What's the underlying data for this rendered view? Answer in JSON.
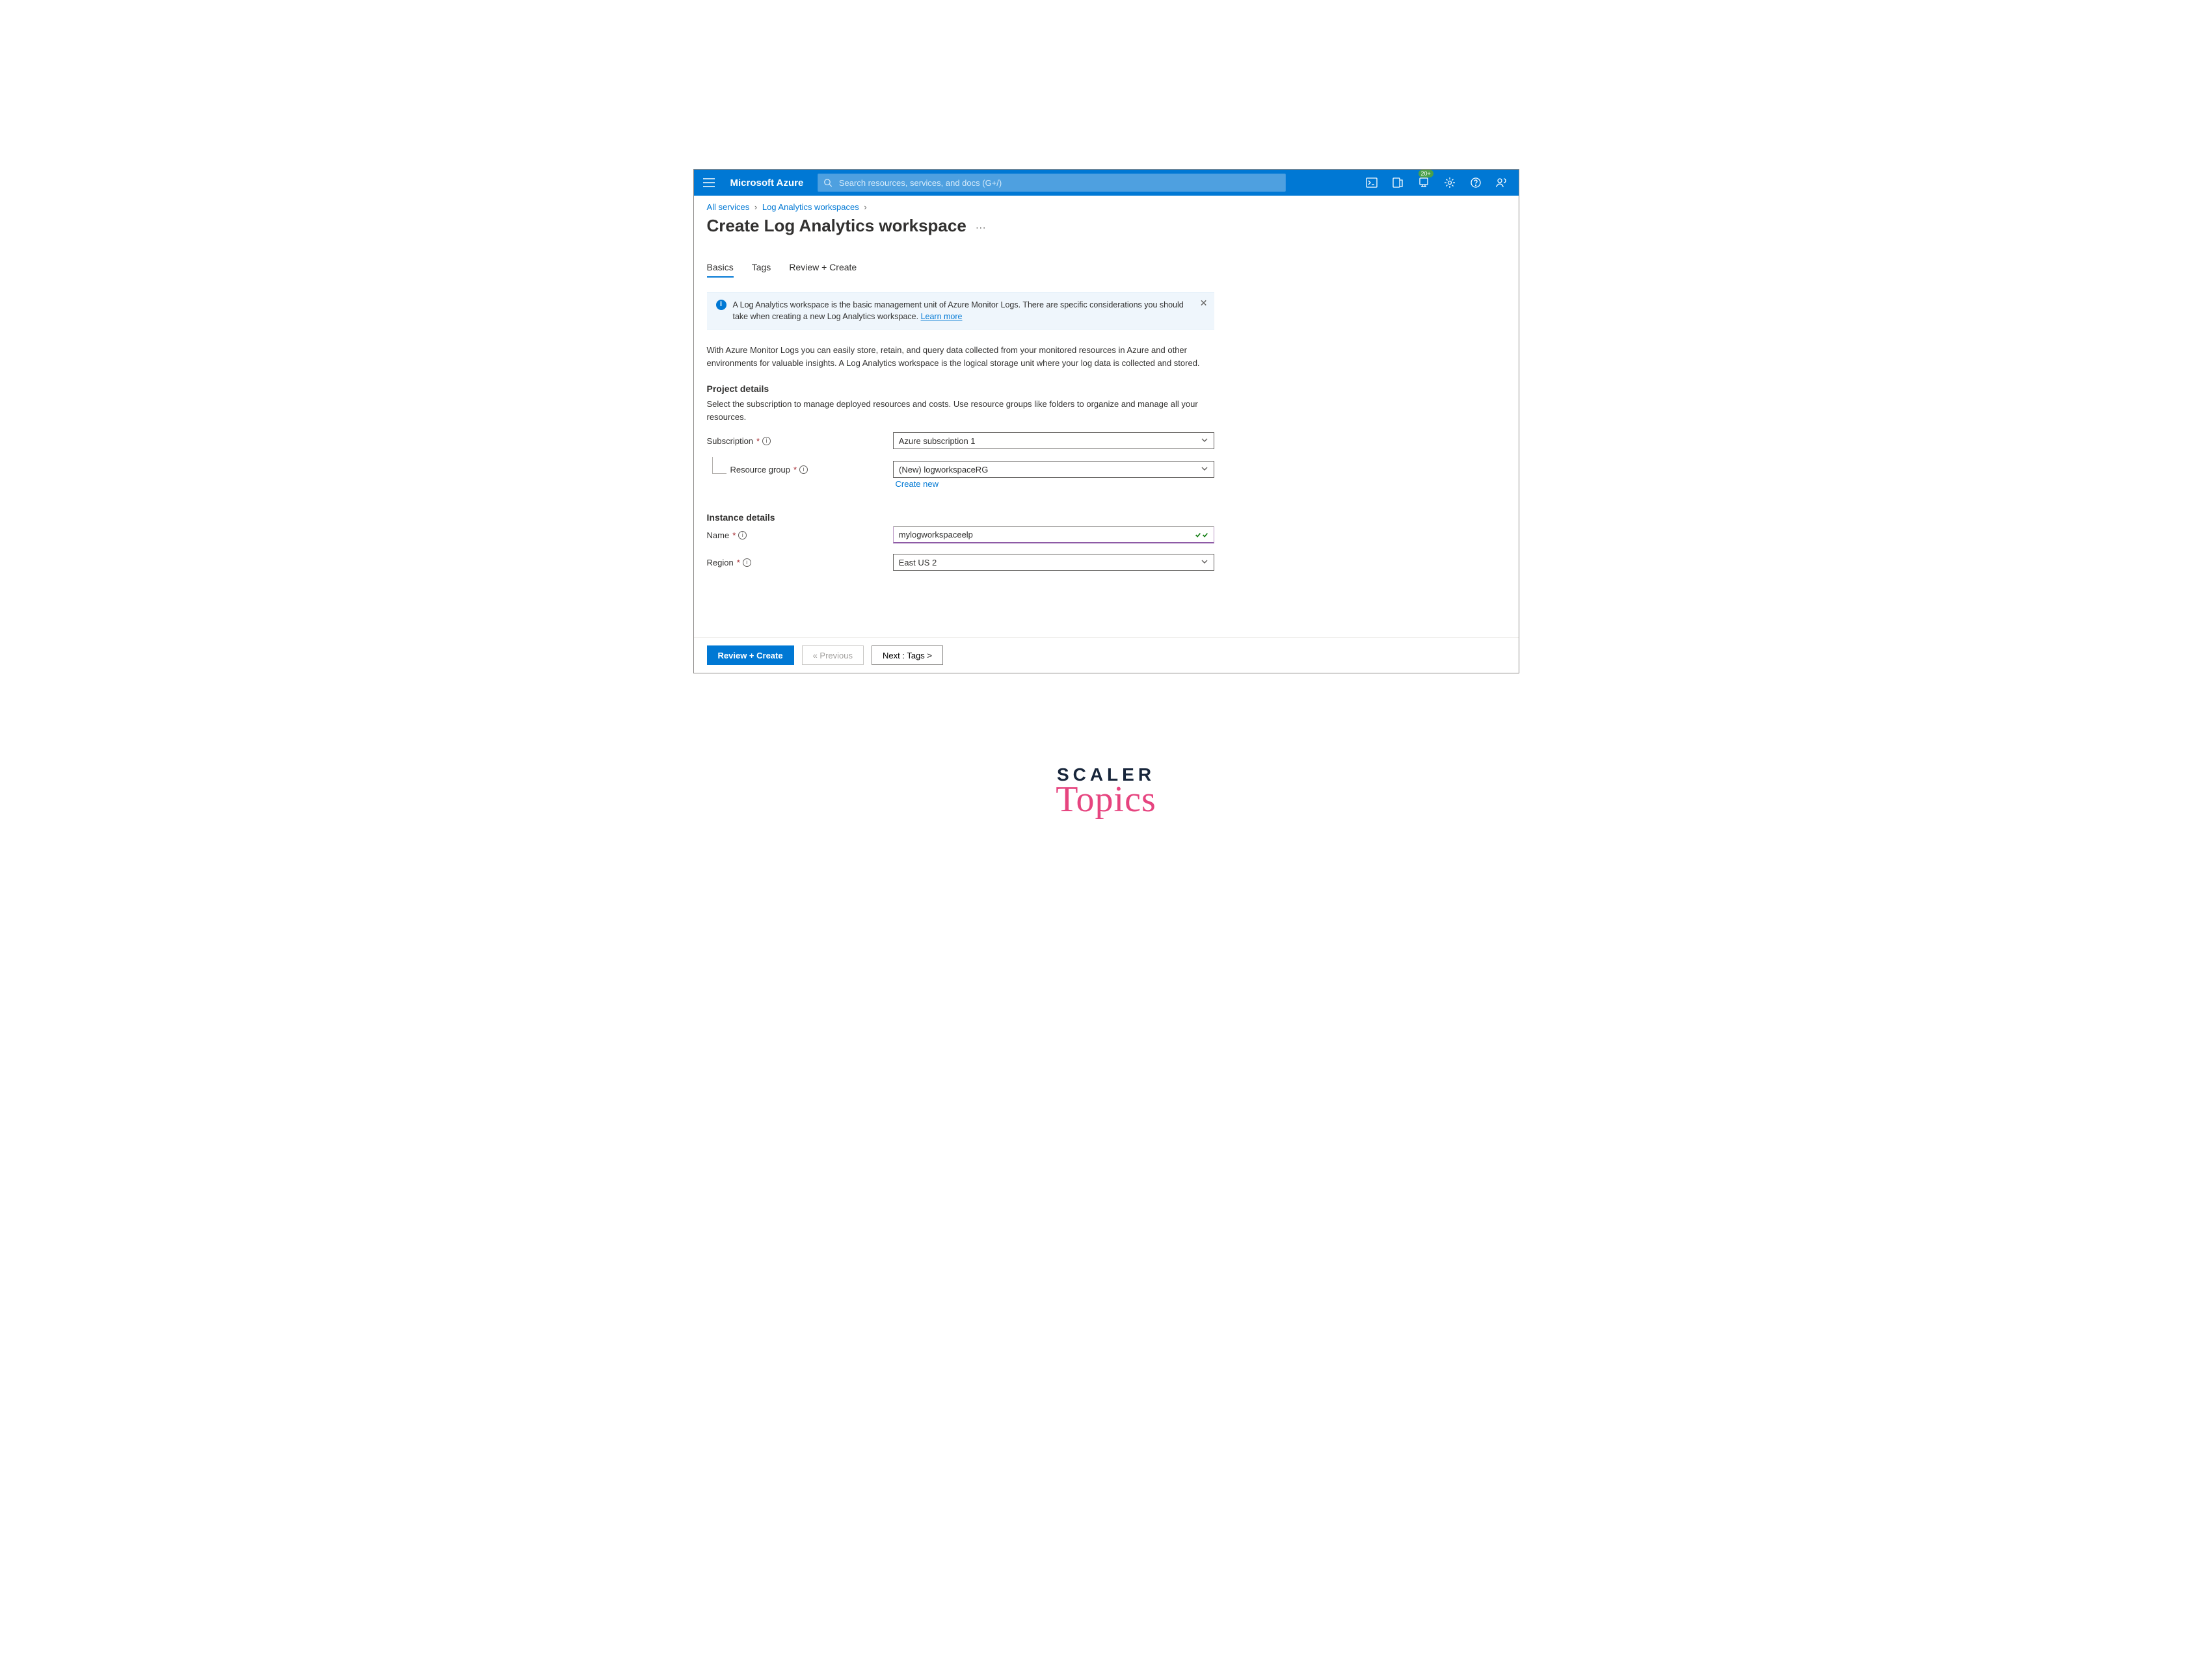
{
  "topbar": {
    "brand": "Microsoft Azure",
    "search_placeholder": "Search resources, services, and docs (G+/)",
    "notification_badge": "20+"
  },
  "breadcrumb": {
    "item1": "All services",
    "item2": "Log Analytics workspaces"
  },
  "page_title": "Create Log Analytics workspace",
  "tabs": {
    "basics": "Basics",
    "tags": "Tags",
    "review": "Review + Create"
  },
  "infobar": {
    "text": "A Log Analytics workspace is the basic management unit of Azure Monitor Logs. There are specific considerations you should take when creating a new Log Analytics workspace. ",
    "learn_more": "Learn more"
  },
  "intro": "With Azure Monitor Logs you can easily store, retain, and query data collected from your monitored resources in Azure and other environments for valuable insights. A Log Analytics workspace is the logical storage unit where your log data is collected and stored.",
  "project_details": {
    "header": "Project details",
    "desc": "Select the subscription to manage deployed resources and costs. Use resource groups like folders to organize and manage all your resources.",
    "subscription_label": "Subscription",
    "subscription_value": "Azure subscription 1",
    "resource_group_label": "Resource group",
    "resource_group_value": "(New) logworkspaceRG",
    "create_new": "Create new"
  },
  "instance_details": {
    "header": "Instance details",
    "name_label": "Name",
    "name_value": "mylogworkspaceelp",
    "region_label": "Region",
    "region_value": "East US 2"
  },
  "footer": {
    "review": "Review + Create",
    "previous": "« Previous",
    "next": "Next : Tags >"
  },
  "watermark": {
    "line1": "SCALER",
    "line2": "Topics"
  }
}
